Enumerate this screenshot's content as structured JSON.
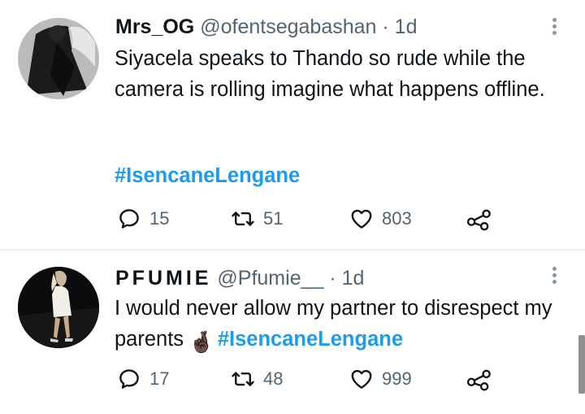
{
  "tweets": [
    {
      "name": "Mrs_OG",
      "handle": "@ofentsegabashan",
      "separator": "·",
      "time": "1d",
      "text": "Siyacela speaks to Thando so rude while the camera is rolling imagine what happens offline.",
      "hashtag": "#IsencaneLengane",
      "replies": "15",
      "retweets": "51",
      "likes": "803"
    },
    {
      "name": "PFUMIE",
      "handle": "@Pfumie__",
      "separator": "·",
      "time": "1d",
      "text": "I would never allow my partner to disrespect my parents",
      "emoji": "🤞🏿",
      "hashtag": "#IsencaneLengane",
      "replies": "17",
      "retweets": "48",
      "likes": "999"
    }
  ],
  "icons": {
    "reply": "speech-bubble-icon",
    "retweet": "retweet-arrows-icon",
    "like": "heart-icon",
    "share": "share-nodes-icon",
    "more": "vertical-ellipsis-icon"
  },
  "colors": {
    "hashtag": "#1d9bf0",
    "secondary_text": "#536471",
    "primary_text": "#0f1419"
  }
}
